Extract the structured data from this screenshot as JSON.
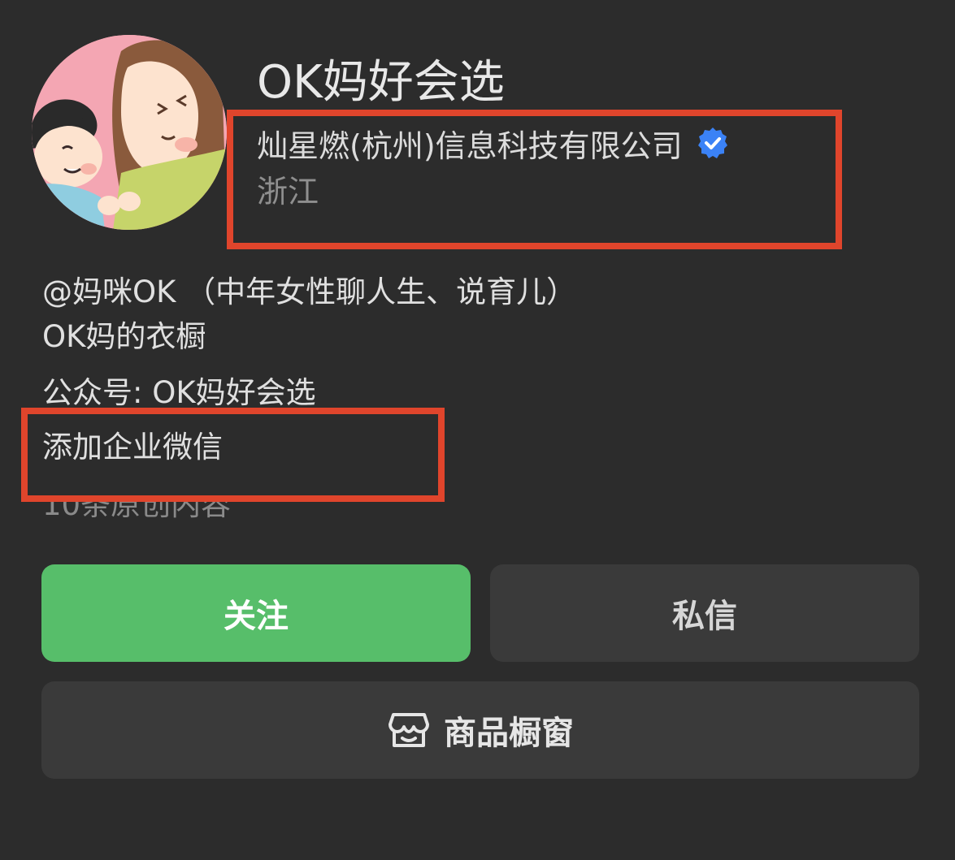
{
  "profile": {
    "name": "OK妈好会选",
    "company": "灿星燃(杭州)信息科技有限公司",
    "region": "浙江",
    "verified_icon": "verified-check-icon"
  },
  "bio": {
    "line1": "@妈咪OK （中年女性聊人生、说育儿）",
    "line2": "OK妈的衣橱"
  },
  "official_account": "公众号: OK妈好会选",
  "add_wecom": "添加企业微信",
  "original_count": "10条原创内容",
  "actions": {
    "follow": "关注",
    "message": "私信",
    "shop": "商品橱窗",
    "shop_icon": "shop-awning-icon"
  },
  "colors": {
    "background": "#2c2c2c",
    "follow_green": "#57be6a",
    "button_gray": "#3a3a3a",
    "highlight_red": "#e0452c",
    "verified_blue": "#3b82f6"
  }
}
